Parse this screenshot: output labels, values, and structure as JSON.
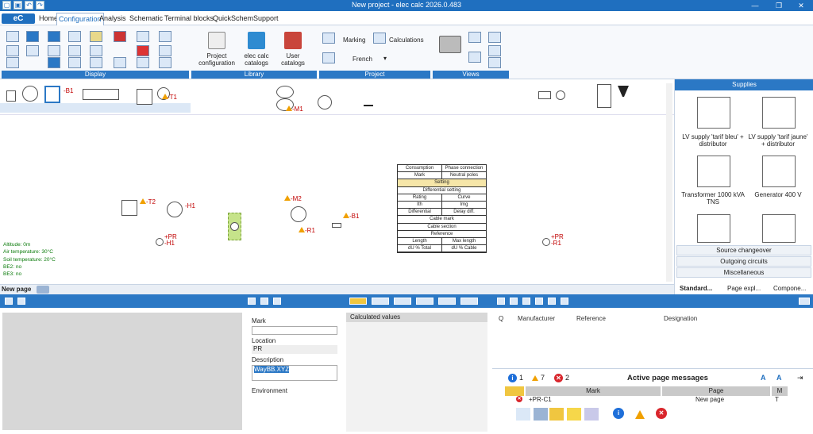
{
  "window": {
    "title": "New project - elec calc 2026.0.483"
  },
  "menu": {
    "logo": "eC",
    "items": [
      "Home",
      "Configuration",
      "Analysis",
      "Schematic",
      "Terminal blocks",
      "QuickSchem",
      "Support"
    ],
    "active": "Configuration"
  },
  "ribbon": {
    "groups": {
      "display": "Display",
      "library": "Library",
      "project": "Project",
      "views": "Views"
    },
    "library": {
      "project_configuration": "Project configuration",
      "elec_calc_catalogs": "elec calc catalogs",
      "user_catalogs": "User catalogs"
    },
    "project": {
      "marking": "Marking",
      "calculations": "Calculations",
      "language": "French"
    }
  },
  "canvas": {
    "labels": {
      "b1_top": "-B1",
      "t1": "-T1",
      "t2": "-T2",
      "h1_top": "-H1",
      "m1": "-M1",
      "m2": "-M2",
      "r1_mid": "-R1",
      "pr_h1": "+PR\n-H1",
      "pr_r1": "+PR\n-R1",
      "b1": "-B1"
    },
    "table_rows": [
      [
        "Consumption",
        "Phase connection"
      ],
      [
        "Mark",
        "Neutral poles"
      ],
      [
        "Setting"
      ],
      [
        "Differential setting"
      ],
      [
        "Rating",
        "Curve"
      ],
      [
        "Ith",
        "Img"
      ],
      [
        "Differential",
        "Delay diff."
      ],
      [
        "Cable mark"
      ],
      [
        "Cable section"
      ],
      [
        "Reference"
      ],
      [
        "Length",
        "Max length"
      ],
      [
        "dU % Total",
        "dU % Cable"
      ]
    ],
    "env_info": [
      "Altitude: 0m",
      "Air temperature: 30°C",
      "Soil temperature: 20°C",
      "BE2: no",
      "BE3: no"
    ],
    "page_tab": "New page"
  },
  "right_panel": {
    "header": "Supplies",
    "items": [
      "LV supply 'tarif bleu' + distributor",
      "LV supply 'tarif jaune' + distributor",
      "Transformer 1000 kVA TNS",
      "Generator 400 V"
    ],
    "categories": [
      "Source changeover",
      "Outgoing circuits",
      "Miscellaneous"
    ],
    "tabs": [
      "Standard...",
      "Page expl...",
      "Compone..."
    ]
  },
  "properties": {
    "mark_label": "Mark",
    "mark_value": "",
    "location_label": "Location",
    "location_value": "PR",
    "description_label": "Description",
    "description_value": "WayBB.XYZ",
    "environment_label": "Environment"
  },
  "calculated": {
    "header": "Calculated values"
  },
  "manufacturer_table": {
    "columns": [
      "Q",
      "Manufacturer",
      "Reference",
      "Designation"
    ]
  },
  "messages": {
    "info_count": "1",
    "warning_count": "7",
    "error_count": "2",
    "title": "Active page messages",
    "columns": [
      "Mark",
      "Page",
      "M"
    ],
    "row": {
      "mark": "+PR-C1",
      "page": "New page",
      "m": "T"
    }
  },
  "colors": {
    "accent": "#2b78c5",
    "titlebar": "#1f6fbf",
    "warning": "#f0a000",
    "error": "#d9262c",
    "info": "#1e6fd9"
  }
}
